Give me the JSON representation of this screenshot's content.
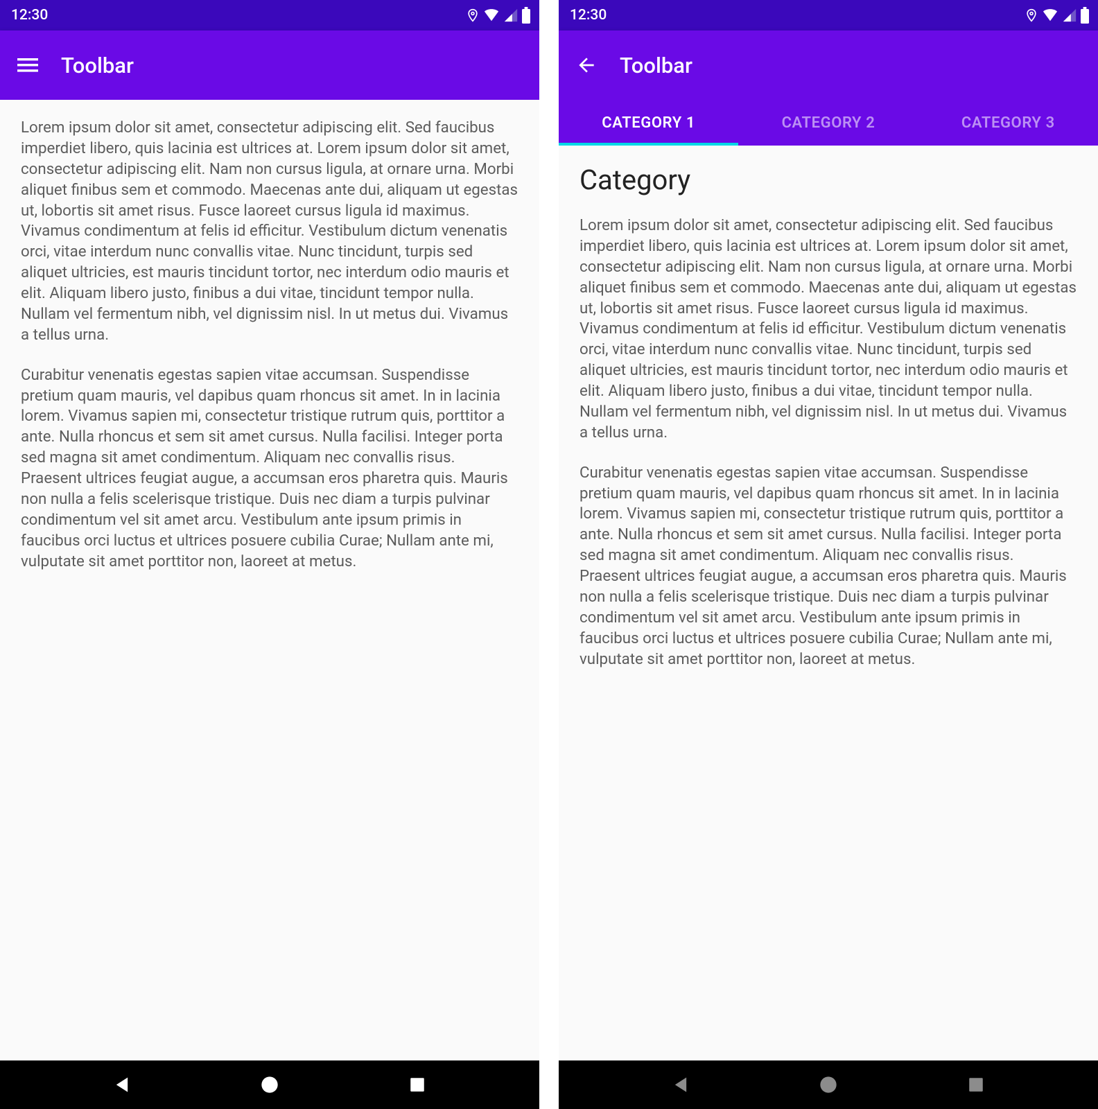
{
  "colors": {
    "statusbar": "#3B08BB",
    "appbar": "#6A0AE6",
    "tab_indicator": "#00D8E6"
  },
  "left": {
    "status_time": "12:30",
    "toolbar_title": "Toolbar",
    "paragraph1": "Lorem ipsum dolor sit amet, consectetur adipiscing elit. Sed faucibus imperdiet libero, quis lacinia est ultrices at. Lorem ipsum dolor sit amet, consectetur adipiscing elit. Nam non cursus ligula, at ornare urna. Morbi aliquet finibus sem et commodo. Maecenas ante dui, aliquam ut egestas ut, lobortis sit amet risus. Fusce laoreet cursus ligula id maximus. Vivamus condimentum at felis id efficitur. Vestibulum dictum venenatis orci, vitae interdum nunc convallis vitae. Nunc tincidunt, turpis sed aliquet ultricies, est mauris tincidunt tortor, nec interdum odio mauris et elit. Aliquam libero justo, finibus a dui vitae, tincidunt tempor nulla. Nullam vel fermentum nibh, vel dignissim nisl. In ut metus dui. Vivamus a tellus urna.",
    "paragraph2": "Curabitur venenatis egestas sapien vitae accumsan. Suspendisse pretium quam mauris, vel dapibus quam rhoncus sit amet. In in lacinia lorem. Vivamus sapien mi, consectetur tristique rutrum quis, porttitor a ante. Nulla rhoncus et sem sit amet cursus. Nulla facilisi. Integer porta sed magna sit amet condimentum. Aliquam nec convallis risus. Praesent ultrices feugiat augue, a accumsan eros pharetra quis. Mauris non nulla a felis scelerisque tristique. Duis nec diam a turpis pulvinar condimentum vel sit amet arcu. Vestibulum ante ipsum primis in faucibus orci luctus et ultrices posuere cubilia Curae; Nullam ante mi, vulputate sit amet porttitor non, laoreet at metus."
  },
  "right": {
    "status_time": "12:30",
    "toolbar_title": "Toolbar",
    "tabs": [
      "CATEGORY 1",
      "CATEGORY 2",
      "CATEGORY 3"
    ],
    "active_tab_index": 0,
    "heading": "Category",
    "paragraph1": "Lorem ipsum dolor sit amet, consectetur adipiscing elit. Sed faucibus imperdiet libero, quis lacinia est ultrices at. Lorem ipsum dolor sit amet, consectetur adipiscing elit. Nam non cursus ligula, at ornare urna. Morbi aliquet finibus sem et commodo. Maecenas ante dui, aliquam ut egestas ut, lobortis sit amet risus. Fusce laoreet cursus ligula id maximus. Vivamus condimentum at felis id efficitur. Vestibulum dictum venenatis orci, vitae interdum nunc convallis vitae. Nunc tincidunt, turpis sed aliquet ultricies, est mauris tincidunt tortor, nec interdum odio mauris et elit. Aliquam libero justo, finibus a dui vitae, tincidunt tempor nulla. Nullam vel fermentum nibh, vel dignissim nisl. In ut metus dui. Vivamus a tellus urna.",
    "paragraph2": "Curabitur venenatis egestas sapien vitae accumsan. Suspendisse pretium quam mauris, vel dapibus quam rhoncus sit amet. In in lacinia lorem. Vivamus sapien mi, consectetur tristique rutrum quis, porttitor a ante. Nulla rhoncus et sem sit amet cursus. Nulla facilisi. Integer porta sed magna sit amet condimentum. Aliquam nec convallis risus. Praesent ultrices feugiat augue, a accumsan eros pharetra quis. Mauris non nulla a felis scelerisque tristique. Duis nec diam a turpis pulvinar condimentum vel sit amet arcu. Vestibulum ante ipsum primis in faucibus orci luctus et ultrices posuere cubilia Curae; Nullam ante mi, vulputate sit amet porttitor non, laoreet at metus."
  }
}
